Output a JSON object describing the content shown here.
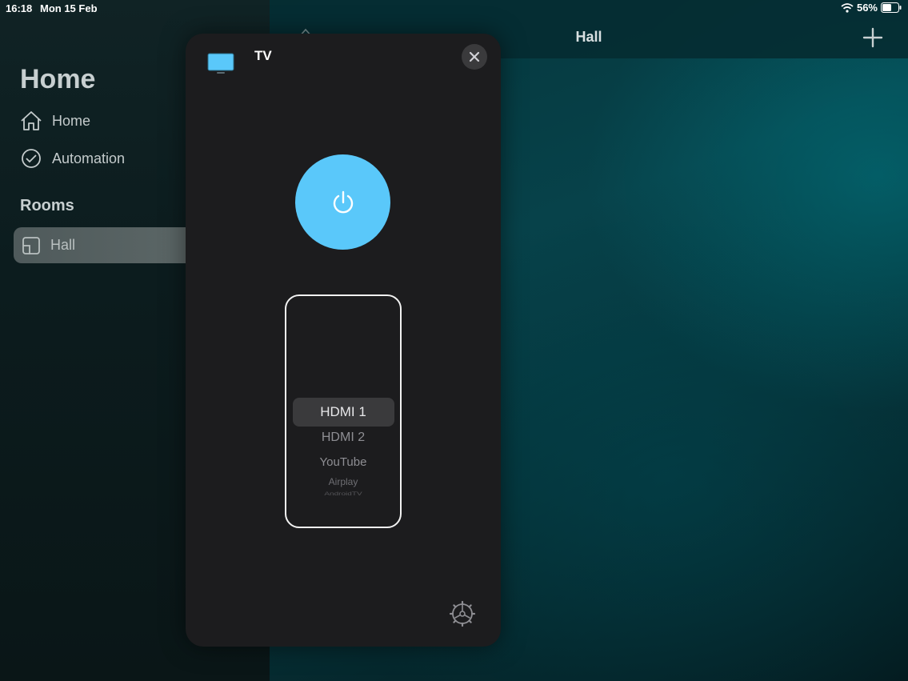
{
  "status_bar": {
    "time": "16:18",
    "date": "Mon 15 Feb",
    "battery": "56%"
  },
  "sidebar": {
    "title": "Home",
    "items": [
      {
        "label": "Home",
        "icon": "house-icon"
      },
      {
        "label": "Automation",
        "icon": "clock-icon"
      }
    ],
    "rooms_title": "Rooms",
    "rooms": [
      {
        "label": "Hall",
        "icon": "room-icon",
        "selected": true
      }
    ]
  },
  "nav": {
    "title": "Hall",
    "add_icon": "plus-icon"
  },
  "modal": {
    "title": "TV",
    "icon": "tv-icon",
    "accent_color": "#5ac8fa",
    "power_icon": "power-icon",
    "close_icon": "close-icon",
    "settings_icon": "gear-icon",
    "input_options": [
      "HDMI 1",
      "HDMI 2",
      "YouTube",
      "Airplay",
      "AndroidTV"
    ],
    "selected_input": "HDMI 1"
  }
}
